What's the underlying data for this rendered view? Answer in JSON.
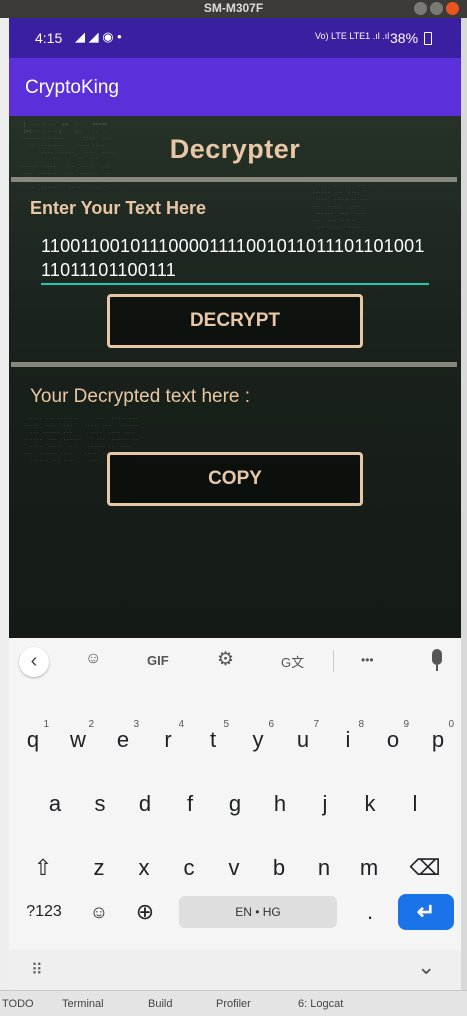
{
  "window": {
    "title": "SM-M307F"
  },
  "status_bar": {
    "time": "4:15",
    "notif_icons": "◢ ◢ ◉ •",
    "network": "Vo) LTE LTE1 .ıl .ıl",
    "battery": "38%"
  },
  "app_bar": {
    "title": "CryptoKing"
  },
  "screen": {
    "heading": "Decrypter",
    "input_label": "Enter Your Text Here",
    "input_value": "11001100101110000111100101101110110100111011101100111",
    "decrypt_button": "DECRYPT",
    "output_label": "Your Decrypted text here :",
    "copy_button": "COPY"
  },
  "keyboard": {
    "toolbar": {
      "back": "‹",
      "sticker": "☺",
      "gif": "GIF",
      "settings": "⚙",
      "translate": "G文",
      "more": "•••",
      "mic": "🎤"
    },
    "row1": [
      {
        "k": "q",
        "n": "1"
      },
      {
        "k": "w",
        "n": "2"
      },
      {
        "k": "e",
        "n": "3"
      },
      {
        "k": "r",
        "n": "4"
      },
      {
        "k": "t",
        "n": "5"
      },
      {
        "k": "y",
        "n": "6"
      },
      {
        "k": "u",
        "n": "7"
      },
      {
        "k": "i",
        "n": "8"
      },
      {
        "k": "o",
        "n": "9"
      },
      {
        "k": "p",
        "n": "0"
      }
    ],
    "row2": [
      "a",
      "s",
      "d",
      "f",
      "g",
      "h",
      "j",
      "k",
      "l"
    ],
    "row3": [
      "z",
      "x",
      "c",
      "v",
      "b",
      "n",
      "m"
    ],
    "shift": "⇧",
    "backspace": "⌫",
    "symbols": "?123",
    "emoji": "☺",
    "globe": "⊕",
    "space": "EN • HG",
    "period": ".",
    "enter": "↵",
    "hide": "⌄",
    "grid": "⠿"
  },
  "ide_bottom": {
    "todo": "TODO",
    "terminal": "Terminal",
    "build": "Build",
    "profiler": "Profiler",
    "logcat": "6: Logcat"
  },
  "colors": {
    "accent": "#5b2fd9",
    "status": "#3a1fa0",
    "text_accent": "#e8c7a6",
    "underline": "#1cc8b0",
    "enter_key": "#1a73e8"
  }
}
